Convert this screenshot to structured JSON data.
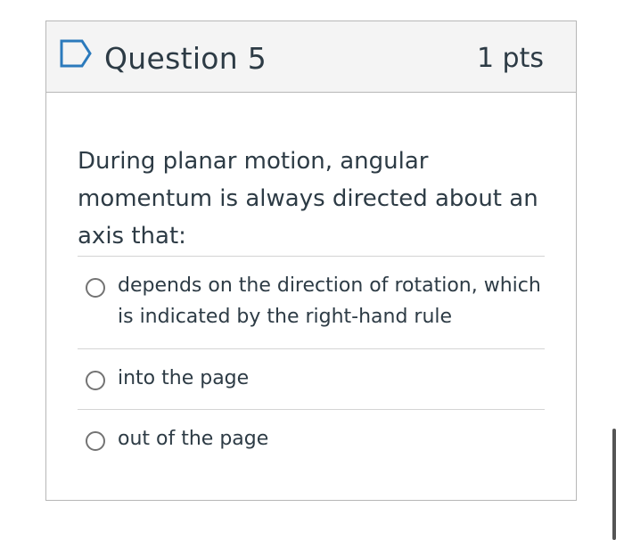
{
  "question": {
    "title": "Question 5",
    "points": "1 pts",
    "text": "During planar motion, angular momentum is always directed about an axis that:",
    "answers": [
      {
        "label": "depends on the direction of rotation, which is indicated by the right-hand rule",
        "selected": false
      },
      {
        "label": "into the page",
        "selected": false
      },
      {
        "label": "out of the page",
        "selected": false
      }
    ]
  },
  "icons": {
    "flag": "flag-icon",
    "radio": "radio-icon"
  },
  "colors": {
    "accent_flag": "#2b7abc",
    "text": "#2d3b45",
    "header_bg": "#f4f4f4",
    "border": "#b7b7b7"
  }
}
